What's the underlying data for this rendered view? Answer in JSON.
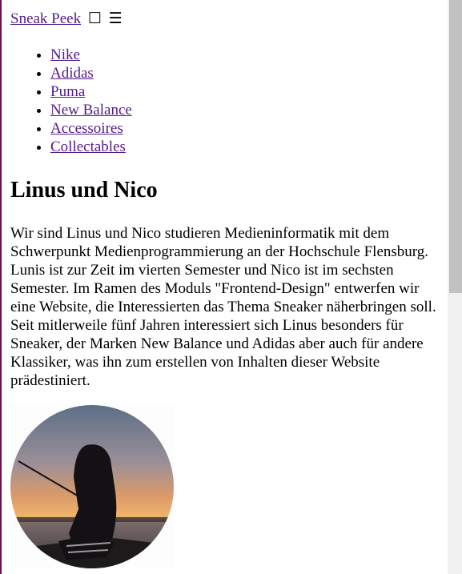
{
  "header": {
    "brand": "Sneak Peek",
    "checkbox_glyph": "☐",
    "menu_glyph": "☰"
  },
  "nav": {
    "items": [
      {
        "label": "Nike"
      },
      {
        "label": "Adidas"
      },
      {
        "label": "Puma"
      },
      {
        "label": "New Balance"
      },
      {
        "label": "Accessoires"
      },
      {
        "label": "Collectables"
      }
    ]
  },
  "main": {
    "title": "Linus und Nico",
    "text": "Wir sind Linus und Nico studieren Medieninformatik mit dem Schwerpunkt Medienprogrammierung an der Hochschule Flensburg. Lunis ist zur Zeit im vierten Semester und Nico ist im sechsten Semester. Im Ramen des Moduls \"Frontend-Design\" entwerfen wir eine Website, die Interessierten das Thema Sneaker näherbringen soll. Seit mitlerweile fünf Jahren interessiert sich Linus besonders für Sneaker, der Marken New Balance und Adidas aber auch für andere Klassiker, was ihn zum erstellen von Inhalten dieser Website prädestiniert."
  },
  "colors": {
    "link": "#551a8b",
    "left_border": "#6b1050",
    "scrollbar_track": "#f1f1f1",
    "scrollbar_thumb": "#c1c1c1"
  },
  "scroll": {
    "thumb_fraction": 0.51
  }
}
